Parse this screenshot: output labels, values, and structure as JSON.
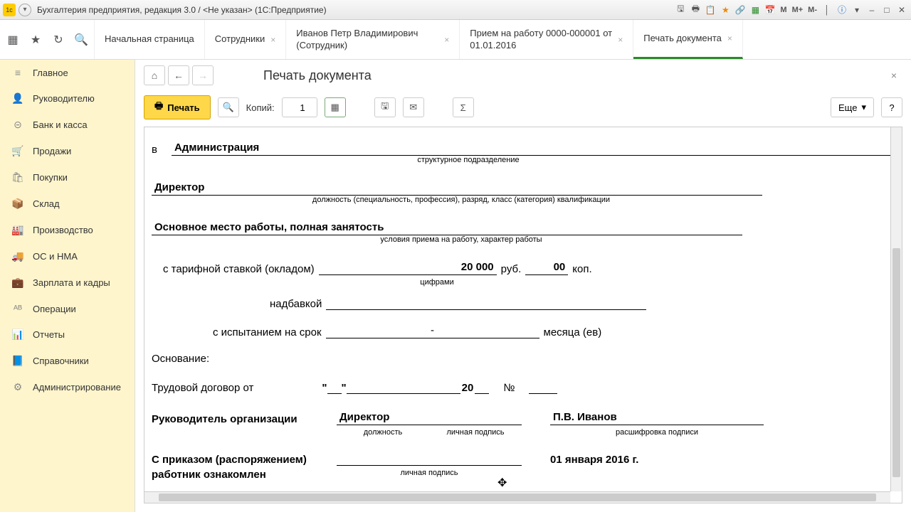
{
  "titlebar": {
    "icon1": "1c",
    "icon2": "▾",
    "title": "Бухгалтерия предприятия, редакция 3.0 / <Не указан>  (1С:Предприятие)"
  },
  "tabbar_tools": [
    "▦",
    "★",
    "↻",
    "🔍"
  ],
  "tabs": [
    {
      "label": "Начальная страница",
      "closable": false
    },
    {
      "label": "Сотрудники",
      "closable": true
    },
    {
      "label": "Иванов Петр Владимирович (Сотрудник)",
      "closable": true
    },
    {
      "label": "Прием на работу 0000-000001 от 01.01.2016",
      "closable": true
    },
    {
      "label": "Печать документа",
      "closable": true,
      "active": true
    }
  ],
  "sidebar": [
    {
      "icon": "≡",
      "label": "Главное"
    },
    {
      "icon": "👤",
      "label": "Руководителю"
    },
    {
      "icon": "⊝",
      "label": "Банк и касса"
    },
    {
      "icon": "🛒",
      "label": "Продажи"
    },
    {
      "icon": "🛍",
      "label": "Покупки"
    },
    {
      "icon": "📦",
      "label": "Склад"
    },
    {
      "icon": "🏭",
      "label": "Производство"
    },
    {
      "icon": "🚚",
      "label": "ОС и НМА"
    },
    {
      "icon": "💼",
      "label": "Зарплата и кадры"
    },
    {
      "icon": "ᴬᴮ",
      "label": "Операции"
    },
    {
      "icon": "📊",
      "label": "Отчеты"
    },
    {
      "icon": "📘",
      "label": "Справочники"
    },
    {
      "icon": "⚙",
      "label": "Администрирование"
    }
  ],
  "page": {
    "title": "Печать документа"
  },
  "toolbar": {
    "print_label": "Печать",
    "copies_label": "Копий:",
    "copies_value": "1",
    "more_label": "Еще",
    "help_label": "?"
  },
  "doc": {
    "prefix_v": "в",
    "department": "Администрация",
    "department_sub": "структурное подразделение",
    "position": "Директор",
    "position_sub": "должность (специальность, профессия), разряд, класс (категория) квалификации",
    "employment": "Основное место работы, полная занятость",
    "employment_sub": "условия приема на работу, характер работы",
    "salary_label": "с тарифной ставкой (окладом)",
    "salary_value": "20 000",
    "rub": "руб.",
    "kop_value": "00",
    "kop": "коп.",
    "digits_sub": "цифрами",
    "bonus_label": "надбавкой",
    "trial_label": "с испытанием на срок",
    "trial_dash": "-",
    "trial_suffix": "месяца (ев)",
    "basis_label": "Основание:",
    "contract_label": "Трудовой договор от",
    "quote_open": "\"",
    "quote_close": "\"",
    "year20": "20",
    "num_label": "№",
    "head_label": "Руководитель организации",
    "head_position": "Директор",
    "position_small": "должность",
    "signature_small": "личная подпись",
    "head_name": "П.В. Иванов",
    "name_decode": "расшифровка  подписи",
    "ack_line1": "С приказом (распоряжением)",
    "ack_line2": "работник ознакомлен",
    "ack_date": "01 января 2016 г."
  }
}
